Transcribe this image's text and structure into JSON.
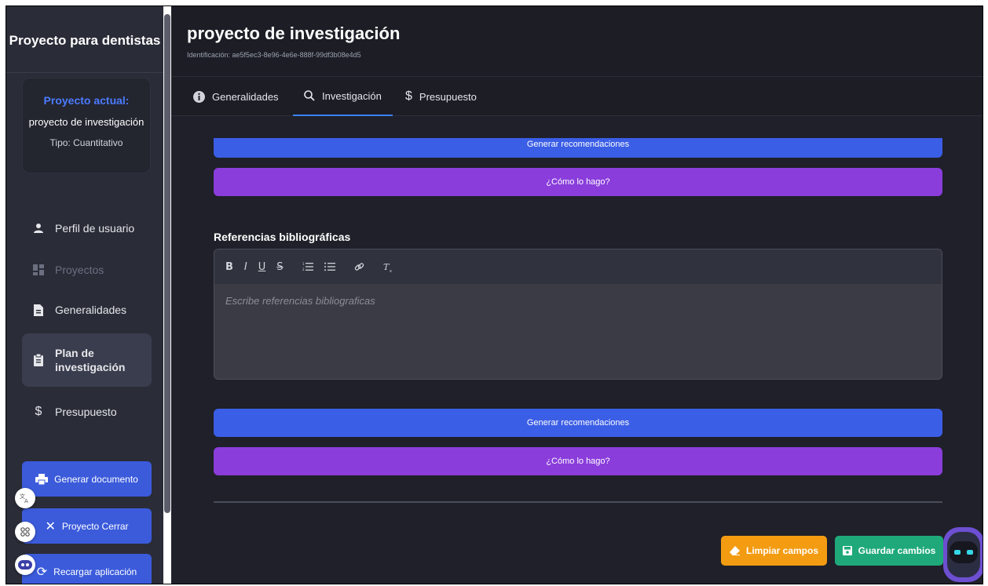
{
  "sidebar": {
    "brand": "Proyecto para dentistas",
    "current_project": {
      "label": "Proyecto actual:",
      "name": "proyecto de investigación",
      "type": "Tipo: Cuantitativo"
    },
    "items": [
      {
        "label": "Perfil de usuario",
        "icon": "user-icon"
      },
      {
        "label": "Proyectos",
        "icon": "grid-icon",
        "disabled": true
      },
      {
        "label": "Generalidades",
        "icon": "file-icon"
      },
      {
        "label": "Plan de investigación",
        "icon": "clipboard-icon",
        "active": true
      },
      {
        "label": "Presupuesto",
        "icon": "dollar-icon"
      }
    ],
    "buttons": {
      "generate": "Generar documento",
      "close": "Proyecto Cerrar",
      "reload": "Recargar aplicación"
    },
    "floating": {
      "translate_icon": "translate-icon",
      "apps_icon": "apps-icon",
      "assistant_icon": "assistant-icon"
    }
  },
  "header": {
    "title": "proyecto de investigación",
    "identifier": "Identificación: ae5f5ec3-8e96-4e6e-888f-99df3b08e4d5"
  },
  "tabs": [
    {
      "label": "Generalidades",
      "icon": "info-icon"
    },
    {
      "label": "Investigación",
      "icon": "search-icon",
      "active": true
    },
    {
      "label": "Presupuesto",
      "icon": "dollar-icon"
    }
  ],
  "content": {
    "top_generate": "Generar recomendaciones",
    "top_how": "¿Cómo lo hago?",
    "section_title": "Referencias bibliográficas",
    "editor": {
      "toolbar": [
        "B",
        "I",
        "U",
        "S",
        "ordered-list",
        "bullet-list",
        "link",
        "clear-format"
      ],
      "placeholder": "Escribe referencias bibliograficas"
    },
    "generate": "Generar recomendaciones",
    "how": "¿Cómo lo hago?"
  },
  "actions": {
    "clear": "Limpiar campos",
    "save": "Guardar cambios"
  },
  "colors": {
    "accent_blue": "#3b5ee6",
    "accent_purple": "#8a3ddb",
    "clear_orange": "#f39c12",
    "save_green": "#1fa97a",
    "label_blue": "#4b7bff"
  }
}
